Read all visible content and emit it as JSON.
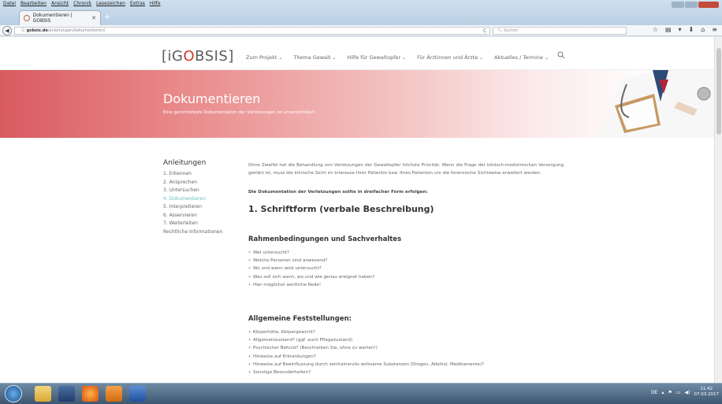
{
  "browser": {
    "menu": [
      "Datei",
      "Bearbeiten",
      "Ansicht",
      "Chronik",
      "Lesezeichen",
      "Extras",
      "Hilfe"
    ],
    "tab_title": "Dokumentieren | GOBSIS",
    "url_domain": "gobsis.de",
    "url_path": "/anleitungen/dokumentieren/",
    "search_placeholder": "Suchen"
  },
  "site": {
    "logo_prefix": "[iG",
    "logo_o": "O",
    "logo_suffix": "BSIS]",
    "nav": [
      "Zum Projekt",
      "Thema Gewalt",
      "Hilfe für Gewaltopfer",
      "Für Ärztinnen und Ärzte",
      "Aktuelles / Termine"
    ]
  },
  "hero": {
    "title": "Dokumentieren",
    "subtitle": "Eine gerichtsfeste Dokumentation der Verletzungen ist unverzichtbar!"
  },
  "sidebar": {
    "title": "Anleitungen",
    "items": [
      {
        "label": "1. Erkennen"
      },
      {
        "label": "2. Ansprechen"
      },
      {
        "label": "3. Untersuchen"
      },
      {
        "label": "4. Dokumentieren",
        "active": true
      },
      {
        "label": "5. Interpretieren"
      },
      {
        "label": "6. Asservieren"
      },
      {
        "label": "7. Weiterleiten"
      },
      {
        "label": "Rechtliche Informationen"
      }
    ]
  },
  "content": {
    "intro": "Ohne Zweifel hat die Behandlung von Verletzungen der Gewaltopfer höchste Priorität. Wenn die Frage der klinisch-medizinischen Versorgung geklärt ist, muss die klinische Sicht im Interesse Ihrer Patientin bzw. Ihres Patienten um die forensische Sichtweise erweitert werden.",
    "bold_line": "Die Dokumentation der Verletzungen sollte in dreifacher Form erfolgen:",
    "heading1": "1. Schriftform (verbale Beschreibung)",
    "section1_title": "Rahmenbedingungen und Sachverhaltes",
    "section1_items": [
      "Wer untersucht?",
      "Welche Personen sind anwesend?",
      "Wo und wann wird untersucht?",
      "Was soll sich wann, wo und wie genau ereignet haben?",
      "Hier möglichst wörtliche Rede!"
    ],
    "section2_title": "Allgemeine Feststellungen:",
    "section2_items": [
      "Körperhöhe, Körpergewicht?",
      "Allgemeinzustand? (ggf. auch Pflegezustand)",
      "Psychischer Befund? (Beschreiben Sie, ohne zu werten!)",
      "Hinweise auf Erkrankungen?",
      "Hinweise auf Beeinflussung durch zentralnervös wirksame Substanzen (Drogen, Alkohol, Medikamente)?",
      "Sonstige Besonderheiten?"
    ]
  },
  "taskbar": {
    "lang": "DE",
    "time": "11:42",
    "date": "07.03.2017"
  },
  "colors": {
    "accent": "#66c2c4",
    "logo_red": "#d8342c",
    "hero_red": "#d85a5f"
  }
}
